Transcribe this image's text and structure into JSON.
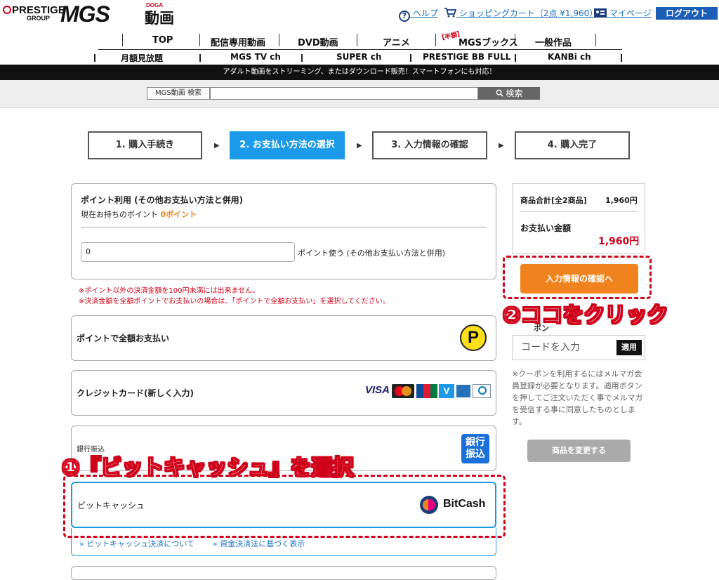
{
  "header": {
    "logo_prestige": "PRESTIGE",
    "logo_group": "GROUP",
    "logo_mgs": "MGS",
    "logo_doga": "DOGA",
    "logo_douga": "動画",
    "help": "ヘルプ",
    "cart": "ショッピングカート（2点 ¥1,960）",
    "mypage": "マイページ",
    "logout": "ログアウト"
  },
  "nav": {
    "row1": [
      "TOP",
      "配信専用動画",
      "DVD動画",
      "アニメ",
      "MGSブックス",
      "一般作品"
    ],
    "half_badge": "【半額】",
    "row2": [
      "月額見放題",
      "MGS TV ch",
      "SUPER ch",
      "PRESTIGE BB FULL",
      "KANBi ch"
    ]
  },
  "banner": "アダルト動画をストリーミング、またはダウンロード販売！スマートフォンにも対応！",
  "search": {
    "label": "MGS動画 検索",
    "button": "検索"
  },
  "steps": [
    "1. 購入手続き",
    "2. お支払い方法の選択",
    "3. 入力情報の確認",
    "4. 購入完了"
  ],
  "active_step_index": 1,
  "points": {
    "title": "ポイント利用 (その他お支払い方法と併用)",
    "current_label": "現在お持ちのポイント",
    "current_value": "0ポイント",
    "input_value": "0",
    "use_label": "ポイント使う (その他お支払い方法と併用)",
    "note1": "※ポイント以外の決済金額を100円未満には出来ません。",
    "note2": "※決済金額を全額ポイントでお支払いの場合は、「ポイントで全額お支払い」を選択してください。"
  },
  "methods": {
    "full_points": "ポイントで全額お支払い",
    "full_points_icon": "P",
    "credit": "クレジットカード(新しく入力)",
    "card_brands": [
      "VISA",
      "MasterCard",
      "JCB",
      "V",
      "AMEX",
      "Diners"
    ],
    "bank": "銀行振込",
    "bank_icon": "銀行振込",
    "bitcash": "ビットキャッシュ",
    "bitcash_logo": "BitCash",
    "bitcash_link1": "» ビットキャッシュ決済について",
    "bitcash_link2": "» 資金決済法に基づく表示"
  },
  "summary": {
    "subtotal_label": "商品合計[全2商品]",
    "subtotal_value": "1,960円",
    "total_label": "お支払い金額",
    "total_value": "1,960円",
    "confirm_button": "入力情報の確認へ"
  },
  "coupon": {
    "heading_partial": "ポン",
    "placeholder": "コードを入力",
    "apply": "適用",
    "note": "※クーポンを利用するにはメルマガ会員登録が必要となります。適用ボタンを押してご注文いただく事でメルマガを受信する事に同意したものとします。"
  },
  "change_button": "商品を変更する",
  "annotations": {
    "step1": "①『ビットキャッシュ』を選択",
    "step2": "②ココをクリック"
  },
  "colors": {
    "active_step": "#1a9ae8",
    "confirm_button": "#f0831e",
    "annotation": "#d0021b",
    "logout": "#1a5eb8"
  }
}
